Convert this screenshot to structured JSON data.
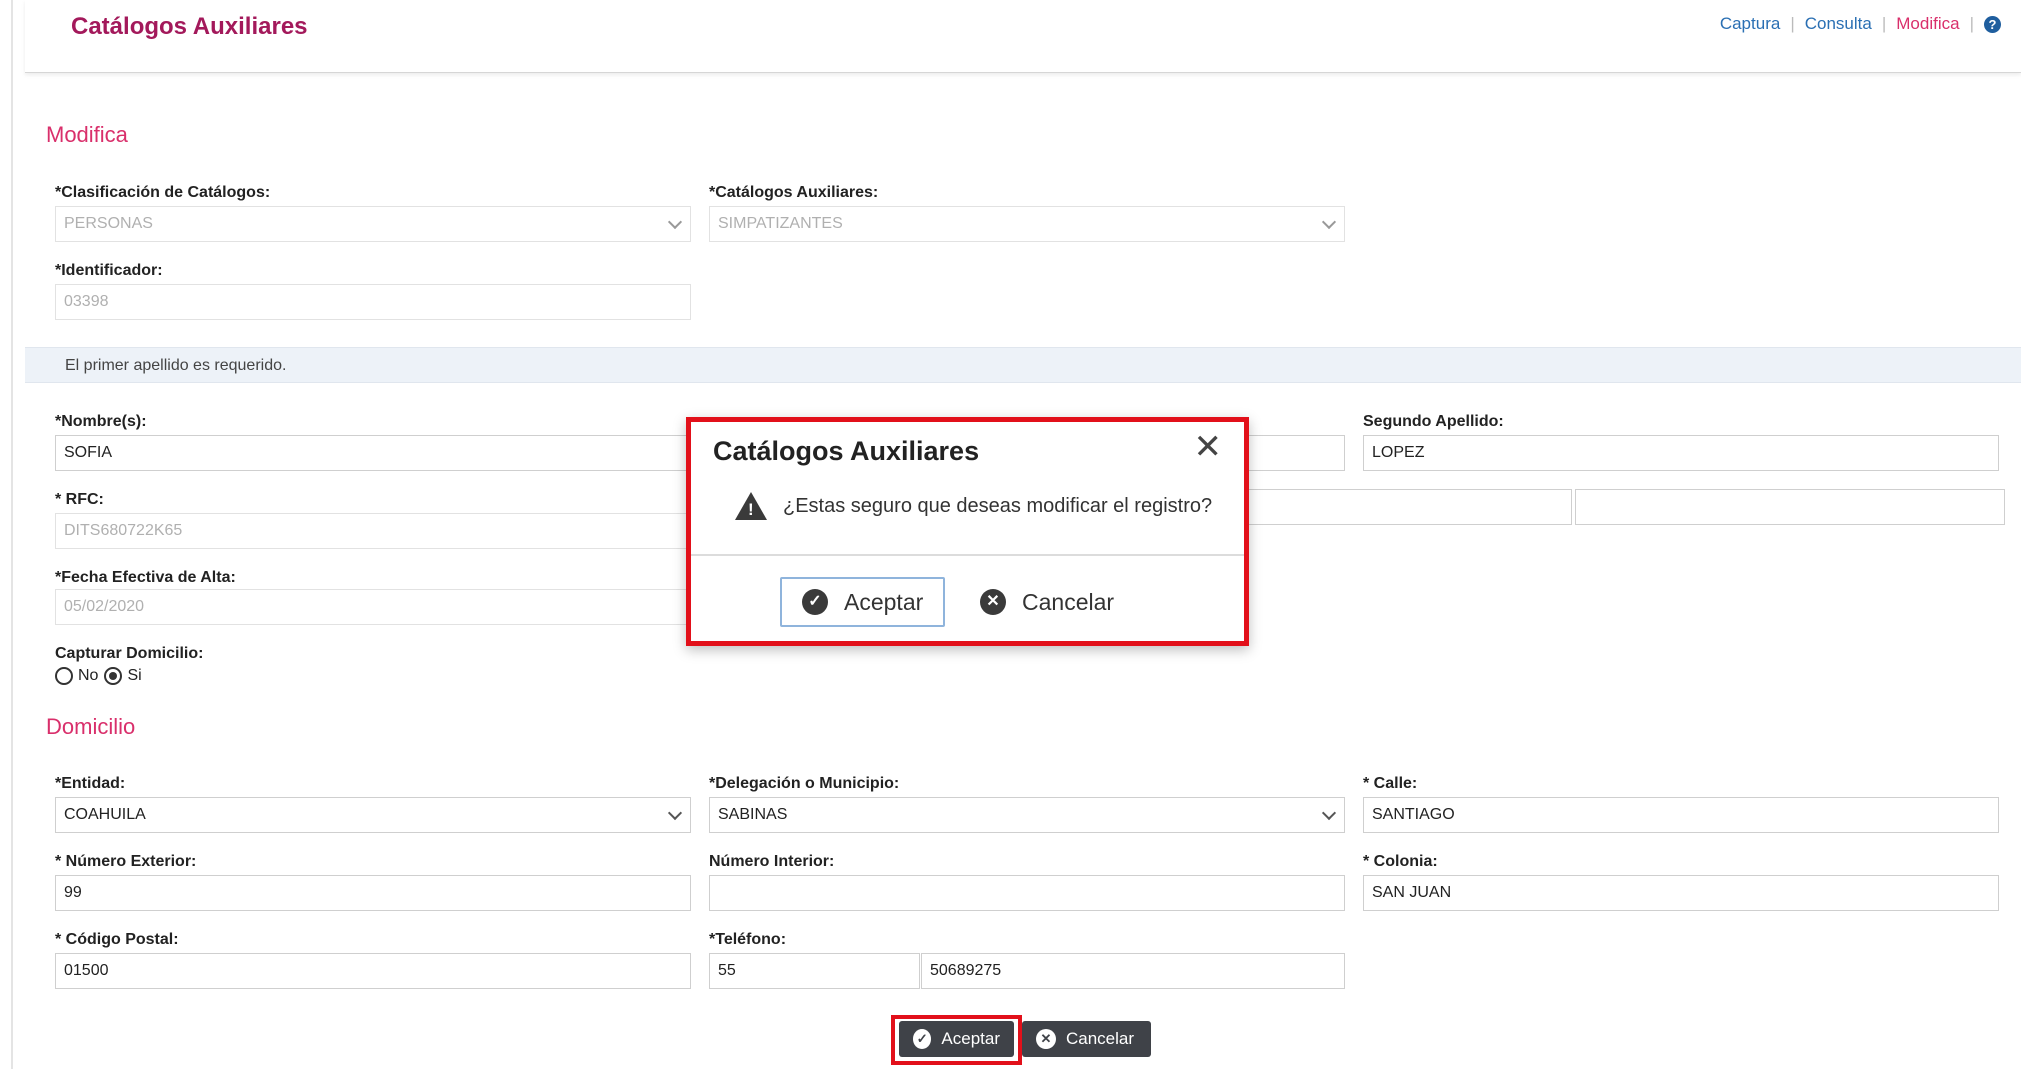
{
  "header": {
    "title": "Catálogos Auxiliares",
    "nav": [
      {
        "label": "Captura"
      },
      {
        "label": "Consulta"
      },
      {
        "label": "Modifica"
      }
    ],
    "help_icon": "?"
  },
  "section": {
    "title": "Modifica",
    "domicilio_title": "Domicilio"
  },
  "form": {
    "clasificacion": {
      "label": "*Clasificación de Catálogos:",
      "value": "PERSONAS"
    },
    "catalogos": {
      "label": "*Catálogos Auxiliares:",
      "value": "SIMPATIZANTES"
    },
    "identificador": {
      "label": "*Identificador:",
      "value": "03398"
    },
    "notice": "El primer apellido es requerido.",
    "nombre": {
      "label": "*Nombre(s):",
      "value": "SOFIA"
    },
    "segundo_apellido": {
      "label": "Segundo Apellido:",
      "value": "LOPEZ"
    },
    "rfc": {
      "label": "* RFC:",
      "value": "DITS680722K65"
    },
    "fecha_alta": {
      "label": "*Fecha Efectiva de Alta:",
      "value": "05/02/2020"
    },
    "capturar_domicilio": {
      "label": "Capturar Domicilio:",
      "no_label": "No",
      "si_label": "Si",
      "selected": "Si"
    }
  },
  "domicilio": {
    "entidad": {
      "label": "*Entidad:",
      "value": "COAHUILA"
    },
    "municipio": {
      "label": "*Delegación o Municipio:",
      "value": "SABINAS"
    },
    "calle": {
      "label": "* Calle:",
      "value": "SANTIAGO"
    },
    "num_ext": {
      "label": "* Número Exterior:",
      "value": "99"
    },
    "num_int": {
      "label": "Número Interior:",
      "value": ""
    },
    "colonia": {
      "label": "* Colonia:",
      "value": "SAN JUAN"
    },
    "cp": {
      "label": "* Código Postal:",
      "value": "01500"
    },
    "telefono": {
      "label": "*Teléfono:",
      "lada": "55",
      "numero": "50689275"
    }
  },
  "buttons": {
    "aceptar": "Aceptar",
    "cancelar": "Cancelar"
  },
  "modal": {
    "title": "Catálogos Auxiliares",
    "message": "¿Estas seguro que deseas modificar el registro?",
    "close": "✕",
    "aceptar": "Aceptar",
    "cancelar": "Cancelar"
  }
}
